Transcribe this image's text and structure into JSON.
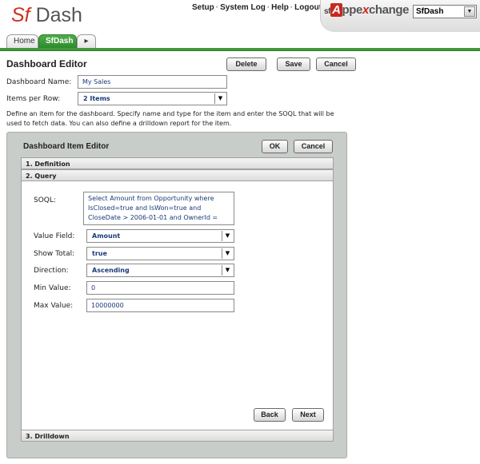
{
  "header": {
    "logo_prefix": "Sf",
    "logo_suffix": "Dash",
    "links": [
      "Setup",
      "System Log",
      "Help",
      "Logout"
    ],
    "appexchange_prefix": "sf",
    "appexchange_a": "A",
    "appexchange_pp": "ppe",
    "appexchange_x": "x",
    "appexchange_rest": "change",
    "app_selected": "SfDash"
  },
  "tabs": {
    "home": "Home",
    "sfdash": "SfDash",
    "more": "▸"
  },
  "editor": {
    "title": "Dashboard Editor",
    "delete_label": "Delete",
    "save_label": "Save",
    "cancel_label": "Cancel",
    "name_label": "Dashboard Name:",
    "name_value": "My Sales",
    "items_label": "Items per Row:",
    "items_value": "2 Items",
    "description": "Define an item for the dashboard. Specify name and type for the item and enter the SOQL that will be used to fetch data. You can also define a drilldown report for the item."
  },
  "item_editor": {
    "title": "Dashboard Item Editor",
    "ok_label": "OK",
    "cancel_label": "Cancel",
    "sections": [
      "1. Definition",
      "2. Query",
      "3. Drilldown"
    ],
    "query": {
      "soql_label": "SOQL:",
      "soql_value": "Select Amount from Opportunity where IsClosed=true and IsWon=true and CloseDate > 2006-01-01 and OwnerId = '$USERID$'",
      "value_field_label": "Value Field:",
      "value_field_value": "Amount",
      "show_total_label": "Show Total:",
      "show_total_value": "true",
      "direction_label": "Direction:",
      "direction_value": "Ascending",
      "min_label": "Min Value:",
      "min_value": "0",
      "max_label": "Max Value:",
      "max_value": "10000000"
    },
    "back_label": "Back",
    "next_label": "Next"
  },
  "colors": {
    "brand_red": "#d0311f",
    "tab_green": "#3f9a3a",
    "panel_gray": "#c9cdc9"
  }
}
